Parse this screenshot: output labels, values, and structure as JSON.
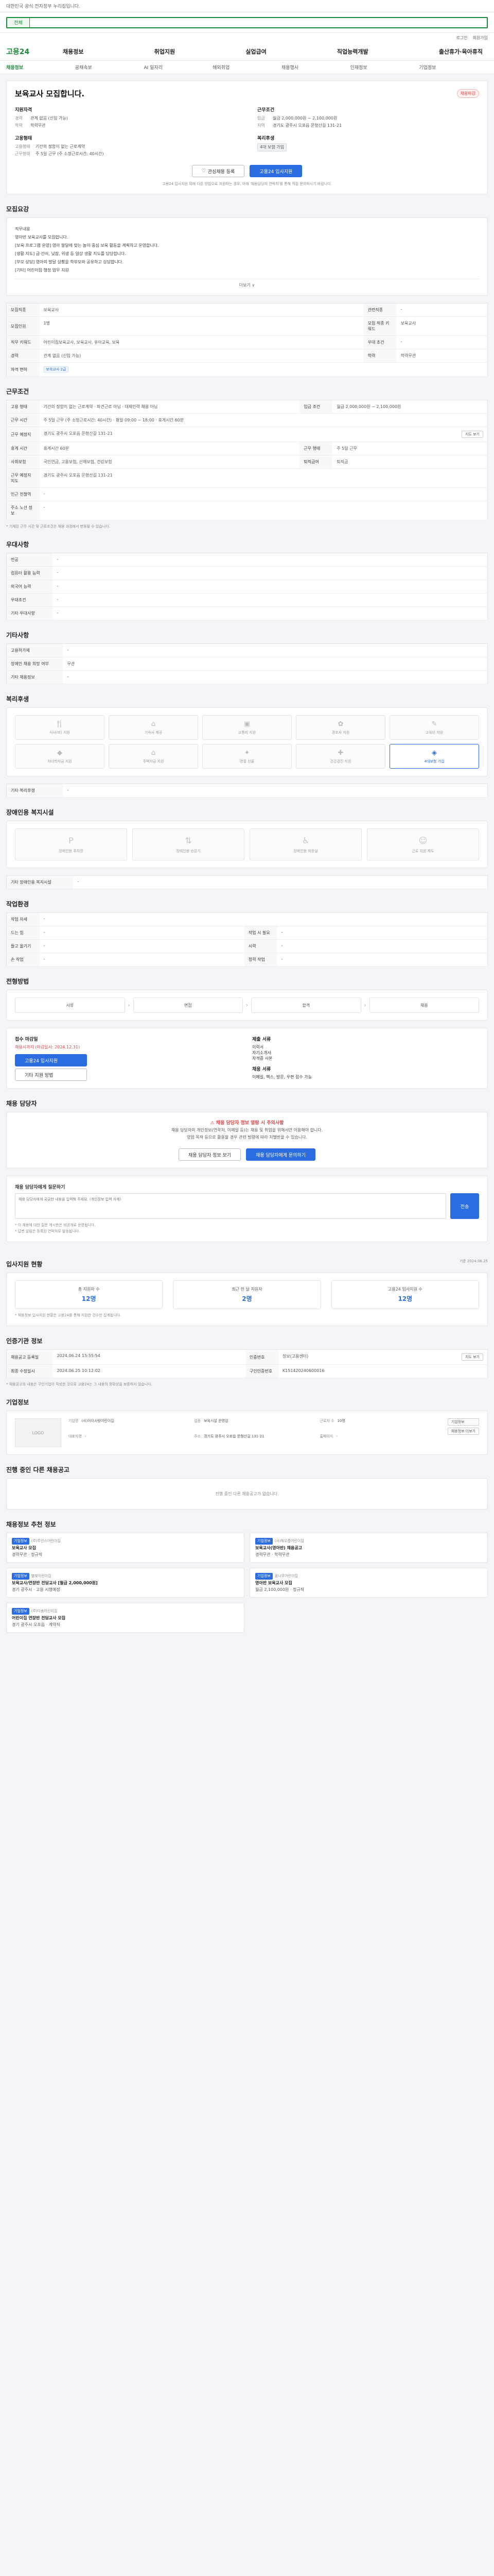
{
  "topbar": {
    "notice": "대한민국 공식 전자정부 누리집입니다."
  },
  "search": {
    "scope": "전체",
    "placeholder": ""
  },
  "util": {
    "login": "로그인",
    "join": "회원가입"
  },
  "gnb": {
    "logo": "고용24",
    "menu": [
      "채용정보",
      "취업지원",
      "실업급여",
      "직업능력개발",
      "출산휴가·육아휴직"
    ]
  },
  "subnav": [
    "채용정보",
    "공채속보",
    "AI 일자리",
    "해외취업",
    "채용행사",
    "인재정보",
    "기업정보"
  ],
  "job": {
    "title": "보육교사 모집합니다.",
    "dday": "채용마감",
    "recruit": {
      "label": "지원자격",
      "rows": [
        [
          "경력",
          "관계 없음 (신입 가능)"
        ],
        [
          "학력",
          "학력무관"
        ]
      ]
    },
    "conditions": {
      "label": "근무조건",
      "rows": [
        [
          "임금",
          "월급 2,000,000원 ~ 2,100,000원"
        ],
        [
          "지역",
          "경기도 광주시 오포읍 문형산길 131-21"
        ]
      ]
    },
    "type": {
      "label": "고용형태",
      "rows": [
        [
          "고용형태",
          "기간의 정함이 없는 근로계약"
        ],
        [
          "근무형태",
          "주 5일 근무 (주 소정근로시간: 40시간)"
        ]
      ]
    },
    "benefit": {
      "label": "복리후생",
      "rows": [
        [
          "",
          "4대 보험 가입"
        ]
      ]
    },
    "save_label": "관심채용 등록",
    "apply_label": "고용24 입사지원",
    "note": "고용24 입사지원 외에 다른 방법으로 지원하는 경우, 아래 '채용담당자 연락처'를 통해 직접 문의하시기 바랍니다."
  },
  "duties": {
    "title": "모집요강",
    "text": [
      "직무내용",
      "영아반 보육교사를 모집합니다.",
      "[보육 프로그램 운영] 영아 발달에 맞는 놀이 중심 보육 활동을 계획하고 운영합니다.",
      "[생활 지도] 급·간식, 낮잠, 위생 등 일상 생활 지도를 담당합니다.",
      "[부모 상담] 영아의 발달 상황을 학부모와 공유하고 상담합니다.",
      "[기타] 어린이집 행정 업무 지원"
    ],
    "more": "더보기 ∨"
  },
  "detail_table": {
    "rows": [
      [
        "모집직종",
        "보육교사",
        "관련직종",
        "-"
      ],
      [
        "모집인원",
        "1명",
        "모집 직종 키워드",
        "보육교사"
      ],
      [
        "직무 키워드",
        "어린이집보육교사, 보육교사, 유아교육, 보육",
        "우대 조건",
        "-"
      ],
      [
        "경력",
        "관계 없음 (신입 가능)",
        "학력",
        "학력무관"
      ],
      [
        "자격 면허",
        "보육교사 2급",
        "",
        ""
      ]
    ]
  },
  "workcond": {
    "title": "근무조건",
    "rows": [
      [
        "고용 형태",
        "기간의 정함이 없는 근로계약 · 파견근로 아님 · 대체인력 채용 아님",
        "임금 조건",
        "월급 2,000,000원 ~ 2,100,000원"
      ],
      [
        "근무 시간",
        "주 5일 근무 (주 소정근로시간: 40시간) · 평일 09:00 ~ 18:00 · 휴게시간 60분",
        "",
        ""
      ],
      [
        "근무 예정지",
        "경기도 광주시 오포읍 문형산길 131-21",
        "",
        ""
      ],
      [
        "휴게 시간",
        "휴게시간 60분",
        "근무 형태",
        "주 5일 근무"
      ],
      [
        "사회보험",
        "국민연금, 고용보험, 산재보험, 건강보험",
        "퇴직급여",
        "퇴직금"
      ],
      [
        "근무 예정지 지도",
        "경기도 광주시 오포읍 문형산길 131-21",
        "",
        ""
      ],
      [
        "인근 전철역",
        "-",
        "",
        ""
      ],
      [
        "주소 노선 정보",
        "-",
        "",
        ""
      ]
    ],
    "map_button": "지도 보기",
    "footnote": "* 기재된 근무 시간 및 근로조건은 채용 과정에서 변동될 수 있습니다."
  },
  "preference": {
    "title": "우대사항",
    "rows": [
      [
        "전공",
        "-"
      ],
      [
        "컴퓨터 활용 능력",
        "-"
      ],
      [
        "외국어 능력",
        "-"
      ],
      [
        "우대조건",
        "-"
      ],
      [
        "기타 우대사항",
        "-"
      ]
    ]
  },
  "etc": {
    "title": "기타사항",
    "rows": [
      [
        "고용허가제",
        "-"
      ],
      [
        "장애인 채용 희망 여부",
        "무관"
      ],
      [
        "기타 채용정보",
        "-"
      ]
    ]
  },
  "welfare": {
    "title": "복리후생",
    "items": [
      "식사(비) 지원",
      "기숙사 제공",
      "교통비 지원",
      "경조사 지원",
      "교육비 지원",
      "자녀학자금 지원",
      "주택자금 지원",
      "명절 선물",
      "건강검진 지원",
      "4대보험 가입"
    ],
    "active": [
      9
    ],
    "etc_label": "기타 복리후생",
    "etc_value": "-"
  },
  "disability": {
    "title": "장애인용 복지시설",
    "items": [
      "장애인용 주차장",
      "장애인용 승강기",
      "장애인용 화장실",
      "근로 지원 제도"
    ],
    "etc_label": "기타 장애인용 복지시설",
    "etc_value": "-"
  },
  "workenv": {
    "title": "작업환경",
    "rows": [
      [
        "작업 자세",
        "-",
        "",
        ""
      ],
      [
        "드는 힘",
        "-",
        "작업 시 필요",
        "-"
      ],
      [
        "들고 옮기기",
        "-",
        "시력",
        "-"
      ],
      [
        "손 작업",
        "-",
        "청력 작업",
        "-"
      ]
    ]
  },
  "process": {
    "title": "전형방법",
    "steps": [
      "서류",
      "면접",
      "합격",
      "채용"
    ]
  },
  "apply": {
    "method_label": "접수 마감일",
    "deadline": "채용시까지 (마감일시: 2024.12.31)",
    "apply_btn": "고용24 입사지원",
    "other_btn": "기타 지원 방법",
    "docs_label": "제출 서류",
    "docs": [
      "이력서",
      "자기소개서",
      "자격증 사본"
    ],
    "cond_label": "채용 서류",
    "cond_value": "이메일, 팩스, 방문, 우편 접수 가능"
  },
  "contact": {
    "title": "채용 담당자",
    "alert": "채용 담당자 정보 열람 시 주의사항",
    "desc1": "채용 담당자의 개인정보(연락처, 이메일 등)는 채용 및 취업을 위해서만 이용해야 합니다.",
    "desc2": "영업 목적 등으로 활용할 경우 관련 법령에 따라 처벌받을 수 있습니다.",
    "btn1": "채용 담당자 정보 보기",
    "btn2": "채용 담당자에게 문의하기",
    "form_label": "채용 담당자에게 질문하기",
    "form_placeholder": "채용 담당자에게 궁금한 내용을 입력해 주세요. (개인정보 입력 자제)",
    "send": "전송",
    "notes": [
      "* 이 채용에 대한 질문 게시판은 비공개로 운영됩니다.",
      "* 답변 알림은 등록된 연락처로 발송됩니다."
    ]
  },
  "stats": {
    "title": "입사지원 현황",
    "sub": "기준 2024.06.25",
    "items": [
      [
        "총 지원자 수",
        "12명"
      ],
      [
        "최근 한 달 지원자",
        "2명"
      ],
      [
        "고용24 입사지원 수",
        "12명"
      ]
    ],
    "footnote": "* 채용정보 입사지원 현황은 고용24를 통해 지원한 건수만 집계됩니다."
  },
  "reginfo": {
    "title": "인증기관 정보",
    "rows": [
      [
        "채용공고 등록일",
        "2024.06.24 15:55:54",
        "인증번호",
        "정보(고용센터)"
      ],
      [
        "최종 수정일시",
        "2024.06.25 10:12:02",
        "구인인증번호",
        "K151420240600016"
      ]
    ],
    "btn": "지도 보기",
    "footnote": "* 채용공고의 내용은 구인기업이 작성한 것으로 고용24는 그 내용의 정확성을 보증하지 않습니다."
  },
  "company": {
    "title": "기업정보",
    "logo": "LOGO",
    "rows": [
      [
        "기업명",
        "(사)아이사랑어린이집"
      ],
      [
        "업종",
        "보육시설 운영업"
      ],
      [
        "근로자 수",
        "10명"
      ],
      [
        "대표자명",
        "-"
      ],
      [
        "주소",
        "경기도 광주시 오포읍 문형산길 131-21"
      ],
      [
        "홈페이지",
        "-"
      ]
    ],
    "btn1": "기업정보",
    "btn2": "채용정보 더보기"
  },
  "others": {
    "title": "진행 중인 다른 채용공고",
    "empty": "진행 중인 다른 채용공고가 없습니다."
  },
  "recommend": {
    "title": "채용정보 추천 정보",
    "cards": [
      {
        "tag": "기업정보",
        "org": "(주)루인스어린이집",
        "title": "보육교사 모집",
        "meta": "경력무관 · 정규직"
      },
      {
        "tag": "기업정보",
        "org": "(사)해오름어린이집",
        "title": "보육교사(영아반) 채용공고",
        "meta": "경력무관 · 학력무관"
      },
      {
        "tag": "기업정보",
        "org": "별빛어린이집",
        "title": "보육교사/연장반 전담교사 [월급 2,000,000원]",
        "meta": "경기 광주시 · 고용 시행예정"
      },
      {
        "tag": "기업정보",
        "org": "꿈나무어린이집",
        "title": "영아반 보육교사 모집",
        "meta": "월급 2,100,000원 · 정규직"
      },
      {
        "tag": "기업정보",
        "org": "(주)다솜어린이집",
        "title": "어린이집 연장반 전담교사 모집",
        "meta": "경기 광주시 오포읍 · 계약직"
      }
    ]
  }
}
